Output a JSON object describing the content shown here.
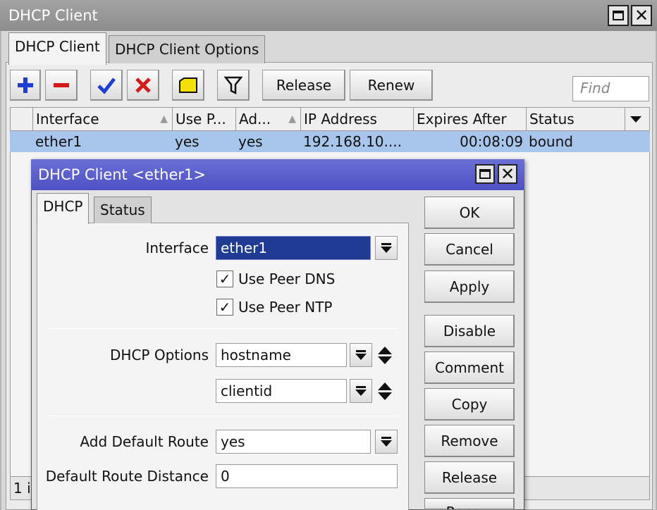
{
  "window": {
    "title": "DHCP Client",
    "tabs": [
      "DHCP Client",
      "DHCP Client Options"
    ]
  },
  "toolbar": {
    "release_label": "Release",
    "renew_label": "Renew",
    "find_placeholder": "Find"
  },
  "table": {
    "columns": [
      "Interface",
      "Use P...",
      "Ad...",
      "IP Address",
      "Expires After",
      "Status"
    ],
    "rows": [
      {
        "interface": "ether1",
        "use_peer": "yes",
        "add": "yes",
        "ip": "192.168.10....",
        "expires": "00:08:09",
        "status": "bound"
      }
    ],
    "row_count": "1 i"
  },
  "dialog": {
    "title": "DHCP Client <ether1>",
    "tabs": [
      "DHCP",
      "Status"
    ],
    "interface_label": "Interface",
    "interface_value": "ether1",
    "use_peer_dns": "Use Peer DNS",
    "use_peer_ntp": "Use Peer NTP",
    "dhcp_options_label": "DHCP Options",
    "dhcp_option_1": "hostname",
    "dhcp_option_2": "clientid",
    "add_default_route_label": "Add Default Route",
    "add_default_route_value": "yes",
    "default_route_distance_label": "Default Route Distance",
    "default_route_distance_value": "0",
    "buttons": [
      "OK",
      "Cancel",
      "Apply",
      "Disable",
      "Comment",
      "Copy",
      "Remove",
      "Release",
      "Renew"
    ]
  },
  "colors": {
    "dialog_title": "#4d51c4",
    "selection": "#a8c6ec",
    "add_icon": "#1d3fd1",
    "remove_icon": "#d61a1a",
    "enable_icon": "#1d3fd1",
    "disable_icon": "#d61a1a",
    "comment_icon": "#f3e100"
  }
}
